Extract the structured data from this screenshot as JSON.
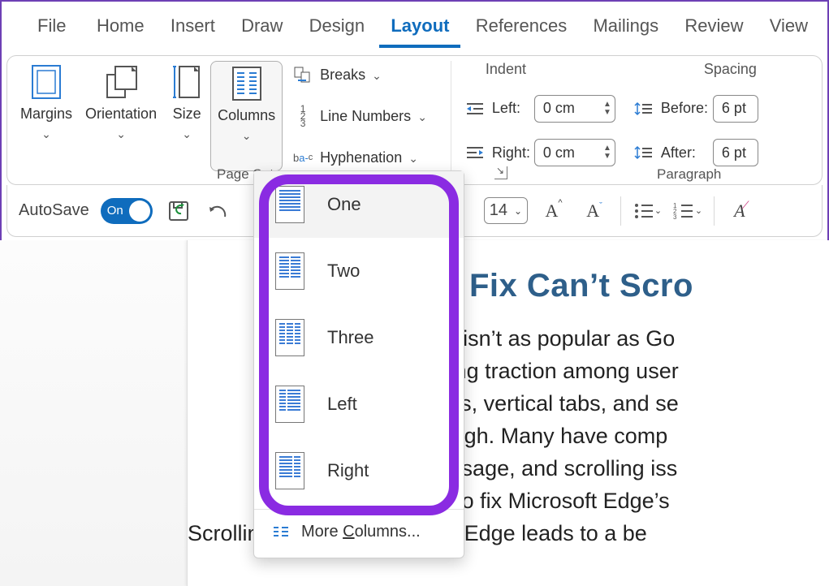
{
  "tabs": {
    "file": "File",
    "home": "Home",
    "insert": "Insert",
    "draw": "Draw",
    "design": "Design",
    "layout": "Layout",
    "references": "References",
    "mailings": "Mailings",
    "review": "Review",
    "view": "View",
    "active": "layout"
  },
  "ribbon": {
    "page_setup": {
      "margins": "Margins",
      "orientation": "Orientation",
      "size": "Size",
      "columns": "Columns",
      "breaks": "Breaks",
      "line_numbers": "Line Numbers",
      "hyphenation": "Hyphenation",
      "group_label": "Page Setup"
    },
    "paragraph": {
      "indent_label": "Indent",
      "spacing_label": "Spacing",
      "left_label": "Left:",
      "right_label": "Right:",
      "left_value": "0 cm",
      "right_value": "0 cm",
      "before_label": "Before:",
      "after_label": "After:",
      "before_value": "6 pt",
      "after_value": "6 pt",
      "group_label": "Paragraph"
    }
  },
  "qab": {
    "autosave_label": "AutoSave",
    "autosave_on": "On",
    "font_size": "14"
  },
  "columns_menu": {
    "one": "One",
    "two": "Two",
    "three": "Three",
    "left": "Left",
    "right": "Right",
    "more_pre": "More ",
    "more_u": "C",
    "more_post": "olumns..."
  },
  "document": {
    "title": "Ways to Fix Can’t Scro",
    "lines": [
      "crosoft Edge isn’t as popular as Go",
      "wser is gaining traction among user",
      "bs, collections, vertical tabs, and se",
      "bug-free though. Many have comp",
      "gh memory usage, and scrolling iss",
      "e best ways to fix Microsoft Edge’s",
      "Scrolling issues in Microsoft Edge leads to a be"
    ]
  }
}
